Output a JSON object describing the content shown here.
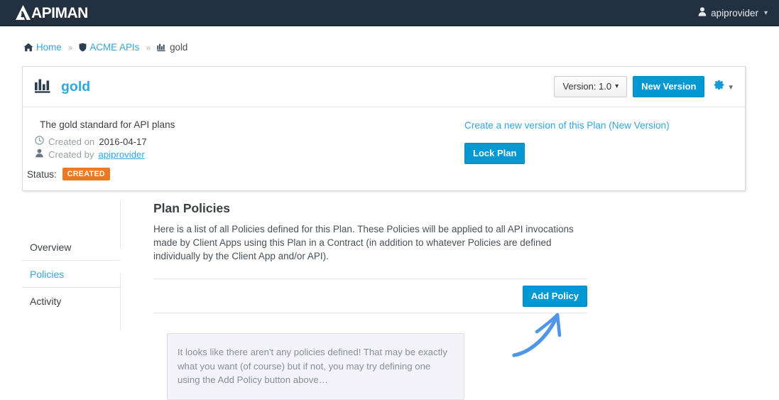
{
  "navbar": {
    "brand": "APIMAN",
    "user": {
      "name": "apiprovider",
      "icon": "person-icon",
      "caret": "chevron-down-icon"
    }
  },
  "breadcrumb": {
    "items": [
      {
        "label": "Home",
        "icon": "home-icon",
        "current": false
      },
      {
        "label": "ACME APIs",
        "icon": "shield-icon",
        "current": false
      },
      {
        "label": "gold",
        "icon": "bar-chart-icon",
        "current": true
      }
    ],
    "separator": "»"
  },
  "plan_card": {
    "title": "gold",
    "title_icon": "bar-chart-icon",
    "version_select": {
      "label": "Version: 1.0",
      "caret": "chevron-down-icon"
    },
    "new_version_button": "New Version",
    "gear_icon": "gear-icon",
    "gear_caret": "chevron-down-icon",
    "description": "The gold standard for API plans",
    "created_on_label": "Created on",
    "created_on_value": "2016-04-17",
    "created_on_icon": "clock-icon",
    "created_by_label": "Created by",
    "created_by_value": "apiprovider",
    "created_by_icon": "person-icon",
    "status_label": "Status:",
    "status_value": "CREATED",
    "new_version_link": "Create a new version of this Plan (New Version)",
    "lock_plan_button": "Lock Plan"
  },
  "sidebar": {
    "items": [
      {
        "label": "Overview",
        "active": false
      },
      {
        "label": "Policies",
        "active": true
      },
      {
        "label": "Activity",
        "active": false
      }
    ]
  },
  "main": {
    "heading": "Plan Policies",
    "description": "Here is a list of all Policies defined for this Plan. These Policies will be applied to all API invocations made by Client Apps using this Plan in a Contract (in addition to whatever Policies are defined individually by the Client App and/or API).",
    "add_policy_button": "Add Policy",
    "empty_state": "It looks like there aren't any policies defined! That may be exactly what you want (of course) but if not, you may try defining one using the Add Policy button above…"
  },
  "annotation": {
    "type": "hand-drawn-arrow",
    "points_to": "Add Policy",
    "color": "#5096e8"
  },
  "colors": {
    "navbar_bg": "#23303f",
    "link_blue": "#31a7dd",
    "primary_button": "#0099d3",
    "status_orange": "#ec7a24",
    "page_bg": "#ffffff",
    "empty_state_bg": "#f3f3f9"
  }
}
